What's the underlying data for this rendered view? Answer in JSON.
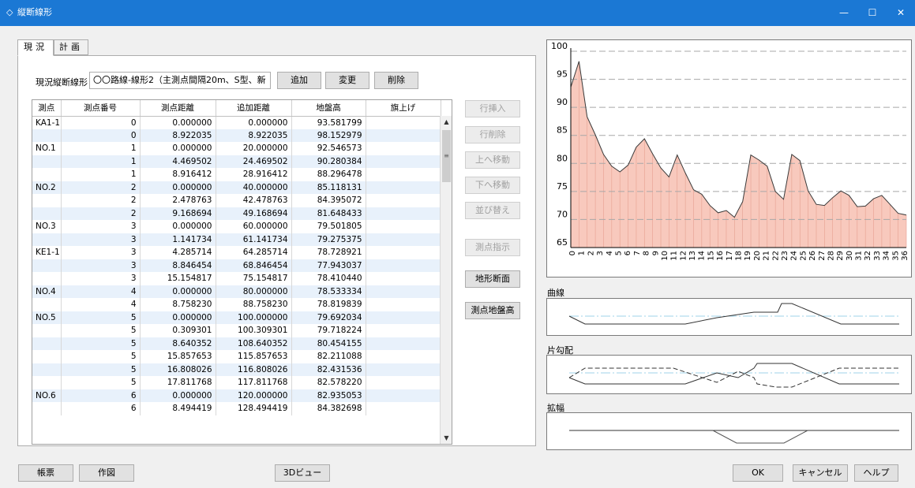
{
  "window": {
    "title": "縦断線形",
    "icon": "app-icon",
    "minimize": "—",
    "maximize": "☐",
    "close": "✕"
  },
  "tabs": [
    {
      "label": "現況",
      "active": true
    },
    {
      "label": "計画",
      "active": false
    }
  ],
  "current_profile": {
    "label": "現況縦断線形",
    "selected": "〇〇路線-線形2（主測点間隔20m、S型、新",
    "add": "追加",
    "change": "変更",
    "delete": "削除"
  },
  "grid": {
    "columns": [
      "測点",
      "測点番号",
      "測点距離",
      "追加距離",
      "地盤高",
      "旗上げ"
    ],
    "rows": [
      [
        "KA1-1",
        "0",
        "0.000000",
        "0.000000",
        "93.581799",
        ""
      ],
      [
        "",
        "0",
        "8.922035",
        "8.922035",
        "98.152979",
        ""
      ],
      [
        "NO.1",
        "1",
        "0.000000",
        "20.000000",
        "92.546573",
        ""
      ],
      [
        "",
        "1",
        "4.469502",
        "24.469502",
        "90.280384",
        ""
      ],
      [
        "",
        "1",
        "8.916412",
        "28.916412",
        "88.296478",
        ""
      ],
      [
        "NO.2",
        "2",
        "0.000000",
        "40.000000",
        "85.118131",
        ""
      ],
      [
        "",
        "2",
        "2.478763",
        "42.478763",
        "84.395072",
        ""
      ],
      [
        "",
        "2",
        "9.168694",
        "49.168694",
        "81.648433",
        ""
      ],
      [
        "NO.3",
        "3",
        "0.000000",
        "60.000000",
        "79.501805",
        ""
      ],
      [
        "",
        "3",
        "1.141734",
        "61.141734",
        "79.275375",
        ""
      ],
      [
        "KE1-1",
        "3",
        "4.285714",
        "64.285714",
        "78.728921",
        ""
      ],
      [
        "",
        "3",
        "8.846454",
        "68.846454",
        "77.943037",
        ""
      ],
      [
        "",
        "3",
        "15.154817",
        "75.154817",
        "78.410440",
        ""
      ],
      [
        "NO.4",
        "4",
        "0.000000",
        "80.000000",
        "78.533334",
        ""
      ],
      [
        "",
        "4",
        "8.758230",
        "88.758230",
        "78.819839",
        ""
      ],
      [
        "NO.5",
        "5",
        "0.000000",
        "100.000000",
        "79.692034",
        ""
      ],
      [
        "",
        "5",
        "0.309301",
        "100.309301",
        "79.718224",
        ""
      ],
      [
        "",
        "5",
        "8.640352",
        "108.640352",
        "80.454155",
        ""
      ],
      [
        "",
        "5",
        "15.857653",
        "115.857653",
        "82.211088",
        ""
      ],
      [
        "",
        "5",
        "16.808026",
        "116.808026",
        "82.431536",
        ""
      ],
      [
        "",
        "5",
        "17.811768",
        "117.811768",
        "82.578220",
        ""
      ],
      [
        "NO.6",
        "6",
        "0.000000",
        "120.000000",
        "82.935053",
        ""
      ],
      [
        "",
        "6",
        "8.494419",
        "128.494419",
        "84.382698",
        ""
      ]
    ]
  },
  "side_buttons": {
    "insert_row": "行挿入",
    "delete_row": "行削除",
    "move_up": "上へ移動",
    "move_down": "下へ移動",
    "sort": "並び替え",
    "station_point": "測点指示",
    "terrain_section": "地形断面",
    "station_elevation": "測点地盤高"
  },
  "bottom_buttons": {
    "report": "帳票",
    "drawing": "作図",
    "view3d": "3Dビュー",
    "ok": "OK",
    "cancel": "キャンセル",
    "help": "ヘルプ"
  },
  "charts": {
    "curve_label": "曲線",
    "cross_slope_label": "片勾配",
    "widening_label": "拡幅"
  },
  "colors": {
    "titlebar": "#1b78d4",
    "profile_fill": "#f8c9bd",
    "profile_line": "#3a3a3a",
    "gridline": "#a8a8a8",
    "centerline": "#9fd3e8"
  },
  "chart_data": {
    "type": "area",
    "ylim": [
      65,
      100
    ],
    "yticks": [
      65,
      70,
      75,
      80,
      85,
      90,
      95,
      100
    ],
    "x": [
      "0",
      "1",
      "2",
      "3",
      "4",
      "5",
      "6",
      "7",
      "8",
      "9",
      "10",
      "11",
      "12",
      "13",
      "14",
      "15",
      "16",
      "17",
      "18",
      "19",
      "20",
      "21",
      "22",
      "23",
      "24",
      "25",
      "26",
      "27",
      "28",
      "29",
      "30",
      "31",
      "32",
      "33",
      "34",
      "35",
      "36"
    ],
    "values": [
      93.6,
      98.2,
      88.3,
      85.1,
      81.6,
      79.5,
      78.5,
      79.7,
      82.9,
      84.4,
      81.7,
      79.2,
      77.6,
      81.5,
      78.3,
      75.3,
      74.5,
      72.5,
      71.2,
      71.6,
      70.4,
      73.2,
      81.5,
      80.6,
      79.5,
      75.0,
      73.6,
      81.6,
      80.5,
      75.1,
      72.7,
      72.5,
      73.9,
      75.1,
      74.3,
      72.3,
      72.4,
      73.7,
      74.3,
      72.7,
      71.1,
      70.8
    ]
  }
}
